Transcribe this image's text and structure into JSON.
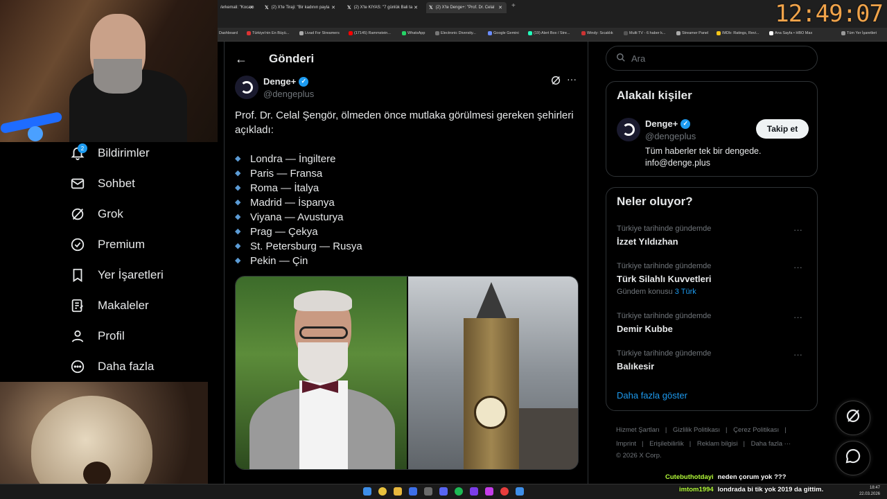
{
  "browser": {
    "tabs": [
      {
        "label": "/erkemali: \"Kocam"
      },
      {
        "label": "(2) X'te Tiraji: \"Bir kadının payla"
      },
      {
        "label": "(2) X'te KIYAS: \"7 günlük Bali ta"
      },
      {
        "label": "(2) X'te Denge+: \"Prof. Dr. Celal"
      }
    ],
    "bookmarks": [
      "Dashboard",
      "Türkiye'nin En Büyü...",
      "Livad For Streamers",
      "(17145) Rammstein...",
      "WhatsApp",
      "Electronic Diversity...",
      "Google Gemini",
      "(19) Alert Box / Stre...",
      "Windy: Sıcaklık",
      "Multi TV - 6 haber k...",
      "Streamer Panel",
      "IMDb: Ratings, Revi...",
      "Ana Sayfa • HBO Max",
      "Tüm Yer İşaretleri"
    ]
  },
  "overlay_clock": "12:49:07",
  "sidebar": {
    "notification_count": "2",
    "items": [
      {
        "label": "Bildirimler",
        "icon": "bell-icon"
      },
      {
        "label": "Sohbet",
        "icon": "mail-icon"
      },
      {
        "label": "Grok",
        "icon": "grok-icon"
      },
      {
        "label": "Premium",
        "icon": "premium-icon"
      },
      {
        "label": "Yer İşaretleri",
        "icon": "bookmark-icon"
      },
      {
        "label": "Makaleler",
        "icon": "article-icon"
      },
      {
        "label": "Profil",
        "icon": "profile-icon"
      },
      {
        "label": "Daha fazla",
        "icon": "more-circle-icon"
      }
    ]
  },
  "post": {
    "header_title": "Gönderi",
    "author_name": "Denge+",
    "author_handle": "@dengeplus",
    "intro": "Prof. Dr. Celal Şengör, ölmeden önce mutlaka görülmesi gereken şehirleri açıkladı:",
    "cities": [
      "Londra — İngiltere",
      "Paris — Fransa",
      "Roma — İtalya",
      "Madrid — İspanya",
      "Viyana — Avusturya",
      "Prag — Çekya",
      "St. Petersburg — Rusya",
      "Pekin — Çin"
    ]
  },
  "right": {
    "search_placeholder": "Ara",
    "related_title": "Alakalı kişiler",
    "related_name": "Denge+",
    "related_handle": "@dengeplus",
    "related_bio": "Tüm haberler tek bir dengede. info@denge.plus",
    "follow_label": "Takip et",
    "trends_title": "Neler oluyor?",
    "trends": [
      {
        "context": "Türkiye tarihinde gündemde",
        "name": "İzzet Yıldızhan",
        "meta_prefix": "",
        "meta_link": ""
      },
      {
        "context": "Türkiye tarihinde gündemde",
        "name": "Türk Silahlı Kuvvetleri",
        "meta_prefix": "Gündem konusu",
        "meta_link": "3 Türk"
      },
      {
        "context": "Türkiye tarihinde gündemde",
        "name": "Demir Kubbe",
        "meta_prefix": "",
        "meta_link": ""
      },
      {
        "context": "Türkiye tarihinde gündemde",
        "name": "Balıkesir",
        "meta_prefix": "",
        "meta_link": ""
      }
    ],
    "show_more": "Daha fazla göster",
    "footer_links": [
      "Hizmet Şartları",
      "Gizlilik Politikası",
      "Çerez Politikası",
      "Imprint",
      "Erişilebilirlik",
      "Reklam bilgisi",
      "Daha fazla ···"
    ],
    "copyright": "© 2026 X Corp."
  },
  "chat": [
    {
      "user": "Cutebuthotdayi",
      "message": "neden çorum yok ???"
    },
    {
      "user": "imtom1994",
      "message": "londrada bi tik yok 2019 da gittim."
    }
  ],
  "taskbar": {
    "time": "18:47",
    "date": "22.03.2026"
  }
}
